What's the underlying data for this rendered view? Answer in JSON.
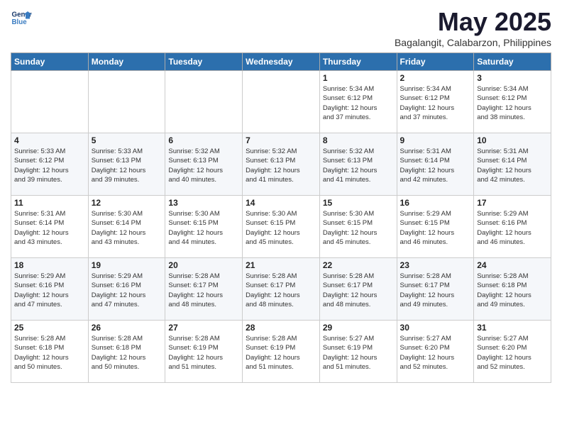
{
  "header": {
    "logo_line1": "General",
    "logo_line2": "Blue",
    "month_title": "May 2025",
    "subtitle": "Bagalangit, Calabarzon, Philippines"
  },
  "days_of_week": [
    "Sunday",
    "Monday",
    "Tuesday",
    "Wednesday",
    "Thursday",
    "Friday",
    "Saturday"
  ],
  "weeks": [
    [
      {
        "day": "",
        "info": ""
      },
      {
        "day": "",
        "info": ""
      },
      {
        "day": "",
        "info": ""
      },
      {
        "day": "",
        "info": ""
      },
      {
        "day": "1",
        "info": "Sunrise: 5:34 AM\nSunset: 6:12 PM\nDaylight: 12 hours\nand 37 minutes."
      },
      {
        "day": "2",
        "info": "Sunrise: 5:34 AM\nSunset: 6:12 PM\nDaylight: 12 hours\nand 37 minutes."
      },
      {
        "day": "3",
        "info": "Sunrise: 5:34 AM\nSunset: 6:12 PM\nDaylight: 12 hours\nand 38 minutes."
      }
    ],
    [
      {
        "day": "4",
        "info": "Sunrise: 5:33 AM\nSunset: 6:12 PM\nDaylight: 12 hours\nand 39 minutes."
      },
      {
        "day": "5",
        "info": "Sunrise: 5:33 AM\nSunset: 6:13 PM\nDaylight: 12 hours\nand 39 minutes."
      },
      {
        "day": "6",
        "info": "Sunrise: 5:32 AM\nSunset: 6:13 PM\nDaylight: 12 hours\nand 40 minutes."
      },
      {
        "day": "7",
        "info": "Sunrise: 5:32 AM\nSunset: 6:13 PM\nDaylight: 12 hours\nand 41 minutes."
      },
      {
        "day": "8",
        "info": "Sunrise: 5:32 AM\nSunset: 6:13 PM\nDaylight: 12 hours\nand 41 minutes."
      },
      {
        "day": "9",
        "info": "Sunrise: 5:31 AM\nSunset: 6:14 PM\nDaylight: 12 hours\nand 42 minutes."
      },
      {
        "day": "10",
        "info": "Sunrise: 5:31 AM\nSunset: 6:14 PM\nDaylight: 12 hours\nand 42 minutes."
      }
    ],
    [
      {
        "day": "11",
        "info": "Sunrise: 5:31 AM\nSunset: 6:14 PM\nDaylight: 12 hours\nand 43 minutes."
      },
      {
        "day": "12",
        "info": "Sunrise: 5:30 AM\nSunset: 6:14 PM\nDaylight: 12 hours\nand 43 minutes."
      },
      {
        "day": "13",
        "info": "Sunrise: 5:30 AM\nSunset: 6:15 PM\nDaylight: 12 hours\nand 44 minutes."
      },
      {
        "day": "14",
        "info": "Sunrise: 5:30 AM\nSunset: 6:15 PM\nDaylight: 12 hours\nand 45 minutes."
      },
      {
        "day": "15",
        "info": "Sunrise: 5:30 AM\nSunset: 6:15 PM\nDaylight: 12 hours\nand 45 minutes."
      },
      {
        "day": "16",
        "info": "Sunrise: 5:29 AM\nSunset: 6:15 PM\nDaylight: 12 hours\nand 46 minutes."
      },
      {
        "day": "17",
        "info": "Sunrise: 5:29 AM\nSunset: 6:16 PM\nDaylight: 12 hours\nand 46 minutes."
      }
    ],
    [
      {
        "day": "18",
        "info": "Sunrise: 5:29 AM\nSunset: 6:16 PM\nDaylight: 12 hours\nand 47 minutes."
      },
      {
        "day": "19",
        "info": "Sunrise: 5:29 AM\nSunset: 6:16 PM\nDaylight: 12 hours\nand 47 minutes."
      },
      {
        "day": "20",
        "info": "Sunrise: 5:28 AM\nSunset: 6:17 PM\nDaylight: 12 hours\nand 48 minutes."
      },
      {
        "day": "21",
        "info": "Sunrise: 5:28 AM\nSunset: 6:17 PM\nDaylight: 12 hours\nand 48 minutes."
      },
      {
        "day": "22",
        "info": "Sunrise: 5:28 AM\nSunset: 6:17 PM\nDaylight: 12 hours\nand 48 minutes."
      },
      {
        "day": "23",
        "info": "Sunrise: 5:28 AM\nSunset: 6:17 PM\nDaylight: 12 hours\nand 49 minutes."
      },
      {
        "day": "24",
        "info": "Sunrise: 5:28 AM\nSunset: 6:18 PM\nDaylight: 12 hours\nand 49 minutes."
      }
    ],
    [
      {
        "day": "25",
        "info": "Sunrise: 5:28 AM\nSunset: 6:18 PM\nDaylight: 12 hours\nand 50 minutes."
      },
      {
        "day": "26",
        "info": "Sunrise: 5:28 AM\nSunset: 6:18 PM\nDaylight: 12 hours\nand 50 minutes."
      },
      {
        "day": "27",
        "info": "Sunrise: 5:28 AM\nSunset: 6:19 PM\nDaylight: 12 hours\nand 51 minutes."
      },
      {
        "day": "28",
        "info": "Sunrise: 5:28 AM\nSunset: 6:19 PM\nDaylight: 12 hours\nand 51 minutes."
      },
      {
        "day": "29",
        "info": "Sunrise: 5:27 AM\nSunset: 6:19 PM\nDaylight: 12 hours\nand 51 minutes."
      },
      {
        "day": "30",
        "info": "Sunrise: 5:27 AM\nSunset: 6:20 PM\nDaylight: 12 hours\nand 52 minutes."
      },
      {
        "day": "31",
        "info": "Sunrise: 5:27 AM\nSunset: 6:20 PM\nDaylight: 12 hours\nand 52 minutes."
      }
    ]
  ]
}
